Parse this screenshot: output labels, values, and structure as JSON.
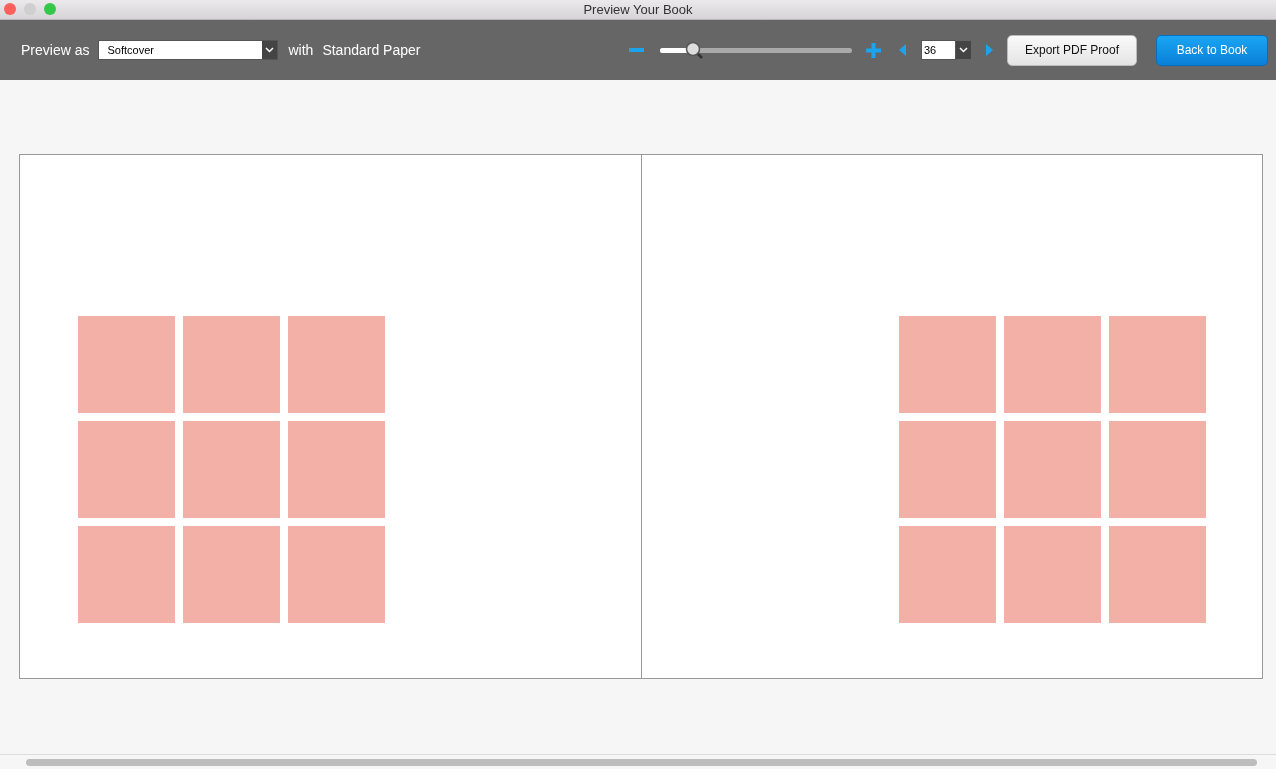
{
  "window": {
    "title": "Preview Your Book"
  },
  "toolbar": {
    "preview_label": "Preview as",
    "binding": {
      "value": "Softcover"
    },
    "with_label": "with",
    "paper": "Standard Paper",
    "zoom": {
      "level": 0.17
    },
    "page_field": {
      "value": "36"
    },
    "buttons": [
      {
        "label": "Export PDF Proof",
        "kind": "secondary"
      },
      {
        "label": "Back to Book",
        "kind": "primary"
      }
    ]
  },
  "spread": {
    "pages": [
      {
        "kind": "left",
        "slots": [
          {
            "kind": "photo"
          },
          {
            "kind": "photo"
          },
          {
            "kind": "photo"
          },
          {
            "kind": "photo"
          },
          {
            "kind": "photo"
          },
          {
            "kind": "photo"
          },
          {
            "kind": "photo"
          },
          {
            "kind": "photo"
          },
          {
            "kind": "photo"
          }
        ]
      },
      {
        "kind": "right",
        "slots": [
          {
            "kind": "photo"
          },
          {
            "kind": "photo"
          },
          {
            "kind": "photo"
          },
          {
            "kind": "photo"
          },
          {
            "kind": "photo"
          },
          {
            "kind": "photo"
          },
          {
            "kind": "photo"
          },
          {
            "kind": "photo"
          },
          {
            "kind": "photo"
          }
        ]
      }
    ]
  }
}
